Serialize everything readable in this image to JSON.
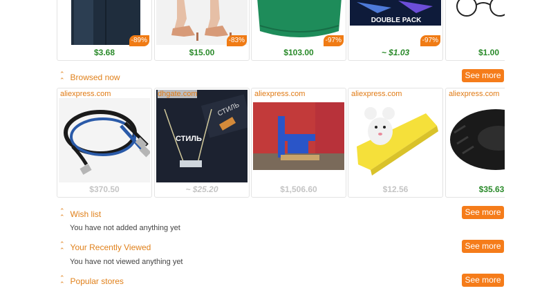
{
  "top_row": [
    {
      "price": "$3.68",
      "badge": "-89%"
    },
    {
      "price": "$15.00",
      "badge": "-83%"
    },
    {
      "price": "$103.00",
      "badge": "-97%"
    },
    {
      "price": "~ $1.03",
      "badge": "-97%",
      "banner": "DOUBLE PACK"
    },
    {
      "price": "$1.00"
    }
  ],
  "browsed": {
    "title": "Browsed now",
    "see_more": "See more",
    "items": [
      {
        "source": "aliexpress.com",
        "price": "$370.50"
      },
      {
        "source": "dhgate.com",
        "price": "~ $25.20",
        "shirt_text": "СТИЛЬ",
        "sleeve_text": "СТИЛЬ"
      },
      {
        "source": "aliexpress.com",
        "price": "$1,506.60"
      },
      {
        "source": "aliexpress.com",
        "price": "$12.56"
      },
      {
        "source": "aliexpress.com",
        "price": "$35.63"
      }
    ]
  },
  "wishlist": {
    "title": "Wish list",
    "see_more": "See more",
    "empty": "You have not added anything yet"
  },
  "recent": {
    "title": "Your Recently Viewed",
    "see_more": "See more",
    "empty": "You have not viewed anything yet"
  },
  "stores": {
    "title": "Popular stores",
    "see_more": "See more"
  },
  "colors": {
    "accent": "#f57c1a",
    "price_green": "#2a8a2a",
    "price_grey": "#c4c4c4"
  }
}
